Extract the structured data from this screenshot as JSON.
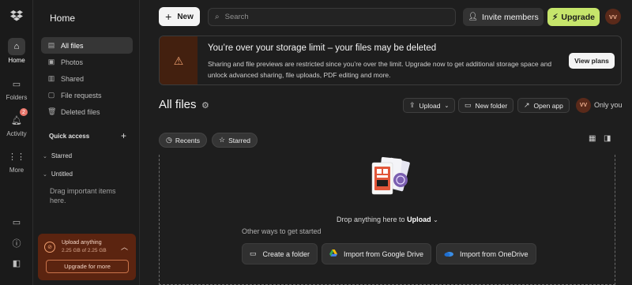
{
  "rail": {
    "items": [
      {
        "label": "Home",
        "icon": "home-icon"
      },
      {
        "label": "Folders",
        "icon": "folder-icon"
      },
      {
        "label": "Activity",
        "icon": "bell-icon",
        "badge": "2"
      },
      {
        "label": "More",
        "icon": "grid-icon"
      }
    ]
  },
  "sidebar": {
    "title": "Home",
    "items": [
      {
        "label": "All files",
        "icon": "file-icon",
        "active": true
      },
      {
        "label": "Photos",
        "icon": "photo-icon"
      },
      {
        "label": "Shared",
        "icon": "shared-icon"
      },
      {
        "label": "File requests",
        "icon": "request-icon"
      },
      {
        "label": "Deleted files",
        "icon": "trash-icon"
      }
    ],
    "quick_access": "Quick access",
    "starred": "Starred",
    "untitled": "Untitled",
    "hint": "Drag important items here."
  },
  "storage": {
    "title": "Upload anything",
    "usage": "2.25 GB of 2.25 GB",
    "button": "Upgrade for more"
  },
  "topbar": {
    "new_label": "New",
    "search_placeholder": "Search",
    "invite_label": "Invite members",
    "upgrade_label": "Upgrade",
    "avatar_initials": "VV"
  },
  "banner": {
    "title": "You’re over your storage limit – your files may be deleted",
    "body": "Sharing and file previews are restricted since you’re over the limit. Upgrade now to get additional storage space and unlock advanced sharing, file uploads, PDF editing and more.",
    "button": "View plans"
  },
  "main": {
    "title": "All files",
    "upload_label": "Upload",
    "new_folder_label": "New folder",
    "open_app_label": "Open app",
    "avatar_initials": "VV",
    "only_you": "Only you",
    "tabs": [
      {
        "label": "Recents"
      },
      {
        "label": "Starred"
      }
    ],
    "drop_text": "Drop anything here to",
    "drop_link": "Upload",
    "other_ways": "Other ways to get started",
    "actions": [
      {
        "label": "Create a folder"
      },
      {
        "label": "Import from Google Drive"
      },
      {
        "label": "Import from OneDrive"
      }
    ]
  },
  "colors": {
    "accent_upgrade": "#c6e56b",
    "warning": "#f0a070",
    "storage_bg": "#5b2410"
  }
}
